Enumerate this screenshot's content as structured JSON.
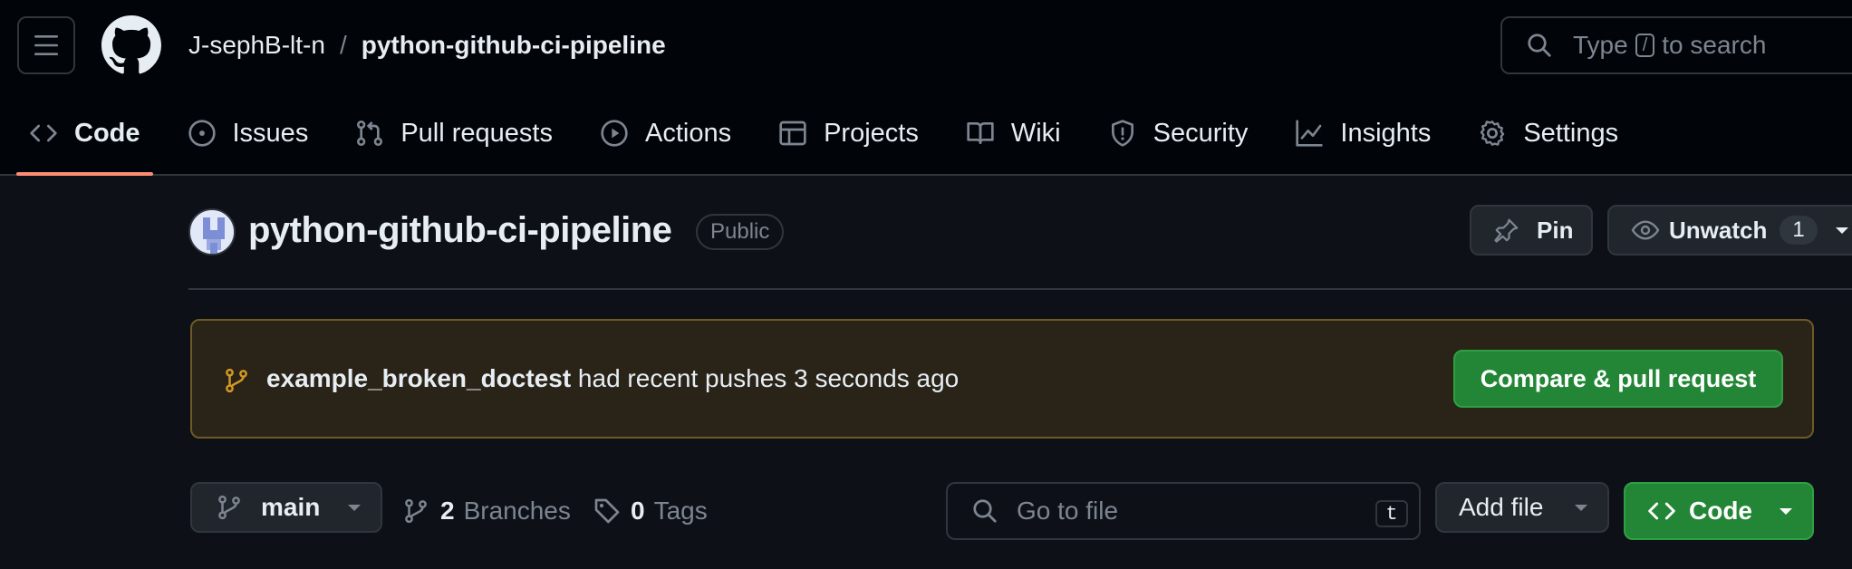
{
  "header": {
    "owner": "J-sephB-lt-n",
    "separator": "/",
    "repo": "python-github-ci-pipeline",
    "search": {
      "before": "Type",
      "key": "/",
      "after": "to search"
    }
  },
  "tabs": [
    {
      "label": "Code",
      "icon": "code-icon",
      "active": true
    },
    {
      "label": "Issues",
      "icon": "issue-opened-icon"
    },
    {
      "label": "Pull requests",
      "icon": "git-pull-request-icon"
    },
    {
      "label": "Actions",
      "icon": "play-icon"
    },
    {
      "label": "Projects",
      "icon": "table-icon"
    },
    {
      "label": "Wiki",
      "icon": "book-icon"
    },
    {
      "label": "Security",
      "icon": "shield-icon"
    },
    {
      "label": "Insights",
      "icon": "graph-icon"
    },
    {
      "label": "Settings",
      "icon": "gear-icon"
    }
  ],
  "repo_header": {
    "name": "python-github-ci-pipeline",
    "visibility": "Public",
    "pin_label": "Pin",
    "unwatch_label": "Unwatch",
    "watch_count": "1"
  },
  "banner": {
    "branch": "example_broken_doctest",
    "message": "had recent pushes 3 seconds ago",
    "button": "Compare & pull request"
  },
  "file_nav": {
    "branch": "main",
    "branches_count": "2",
    "branches_label": "Branches",
    "tags_count": "0",
    "tags_label": "Tags",
    "goto_placeholder": "Go to file",
    "goto_key": "t",
    "add_file": "Add file",
    "code": "Code"
  },
  "colors": {
    "background": "#0d1117",
    "header_bg": "#010409",
    "active_tab_underline": "#fd8c73",
    "primary_button": "#238636",
    "banner_bg": "#2a2318",
    "banner_border": "#6e5a25",
    "branch_icon": "#d29922"
  }
}
